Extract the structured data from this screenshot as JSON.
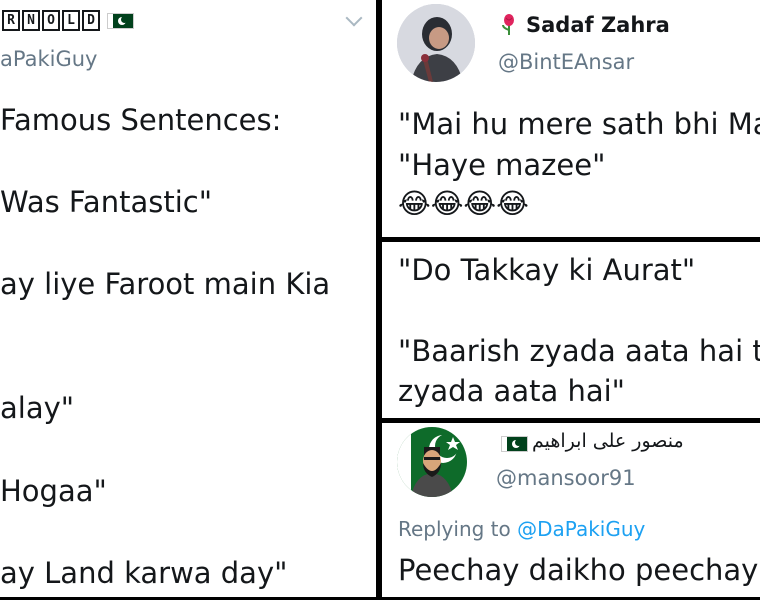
{
  "left_tweet": {
    "arnold_letters": [
      "R",
      "N",
      "O",
      "L",
      "D"
    ],
    "handle": "aPakiGuy",
    "lines": [
      "Famous Sentences:",
      "Was Fantastic\"",
      "ay liye Faroot main Kia",
      "alay\"",
      "Hogaa\"",
      "ay Land karwa day\""
    ]
  },
  "tweet_sadaf": {
    "name": "Sadaf Zahra",
    "handle": "@BintEAnsar",
    "line1": "\"Mai hu mere sath bhi Ma",
    "line2": "\"Haye mazee\"",
    "emoji": "😂😂😂😂"
  },
  "tweet_mid": {
    "line1": "\"Do Takkay ki Aurat\"",
    "line2": "\"Baarish zyada aata hai to",
    "line3": "zyada aata hai\""
  },
  "tweet_mansoor": {
    "name": "منصور علی ابراهیم",
    "handle": "@mansoor91",
    "replying_prefix": "Replying to",
    "replying_handle": "@DaPakiGuy",
    "text": "Peechay daikho peechay"
  }
}
